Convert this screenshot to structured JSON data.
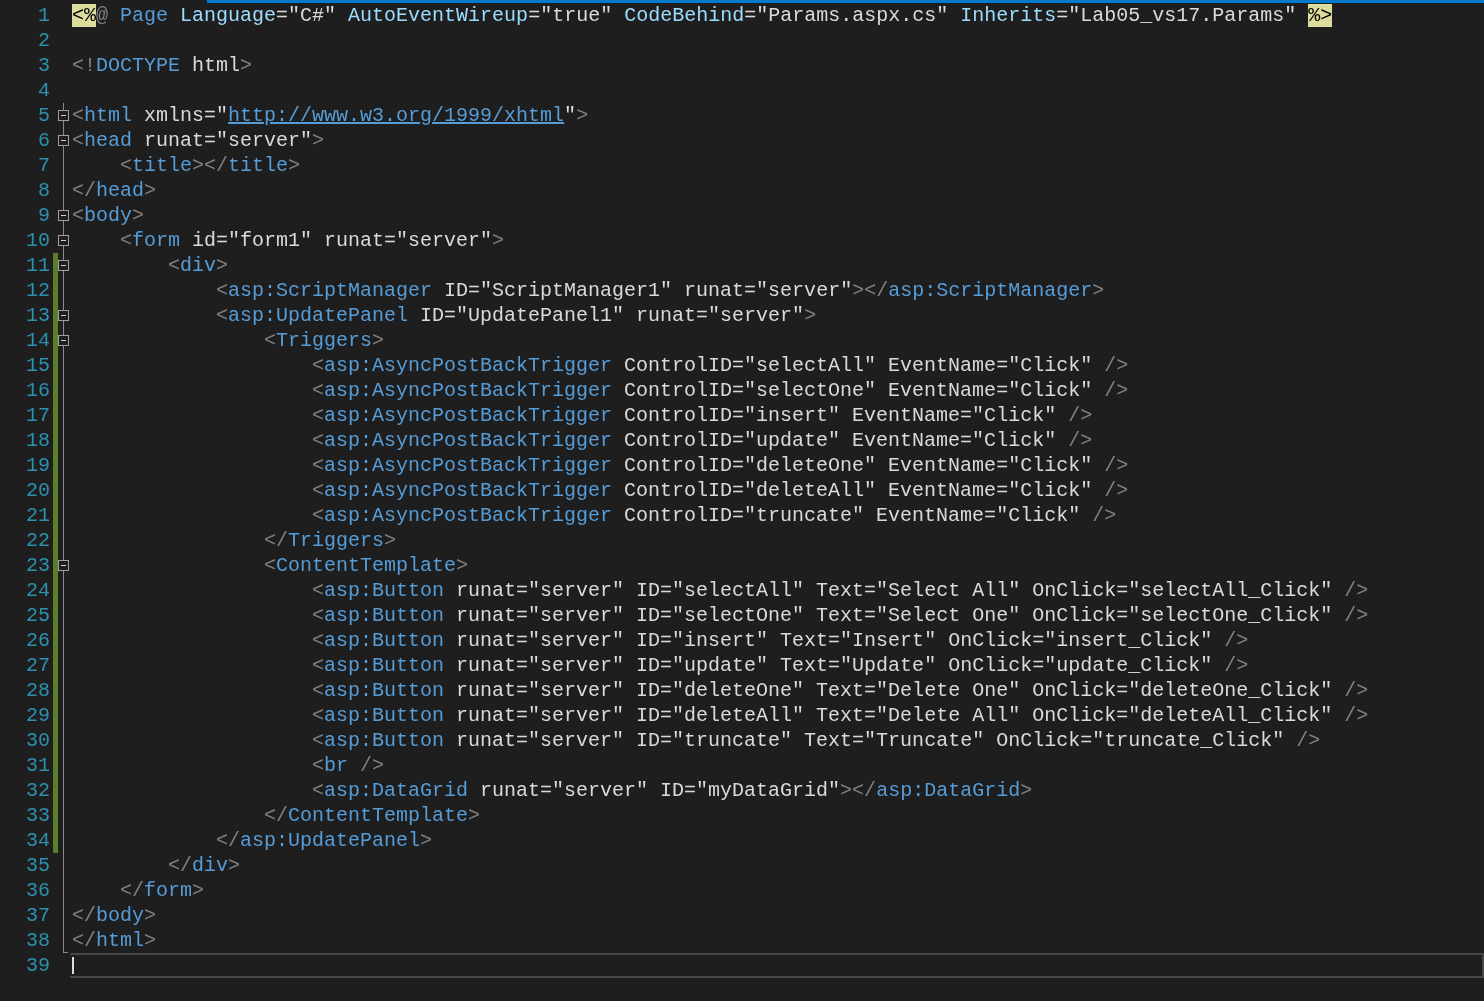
{
  "editor": {
    "lines": [
      {
        "number": "1",
        "changed": false,
        "fold_toggle": false,
        "current": false,
        "tokens": [
          {
            "kind": "directive",
            "text": "<%"
          },
          {
            "kind": "punct",
            "text": "@"
          },
          {
            "kind": "tag",
            "text": " Page"
          },
          {
            "kind": "attr",
            "text": " Language"
          },
          {
            "kind": "text",
            "text": "=\"C#\""
          },
          {
            "kind": "attr",
            "text": " AutoEventWireup"
          },
          {
            "kind": "text",
            "text": "=\"true\""
          },
          {
            "kind": "attr",
            "text": " CodeBehind"
          },
          {
            "kind": "text",
            "text": "=\"Params.aspx.cs\""
          },
          {
            "kind": "attr",
            "text": " Inherits"
          },
          {
            "kind": "text",
            "text": "=\"Lab05_vs17.Params\" "
          },
          {
            "kind": "directive",
            "text": "%>"
          }
        ]
      },
      {
        "number": "2",
        "changed": false,
        "fold_toggle": false,
        "current": false
      },
      {
        "number": "3",
        "changed": false,
        "fold_toggle": false,
        "current": false,
        "tokens": [
          {
            "kind": "punct",
            "text": "<!"
          },
          {
            "kind": "tag",
            "text": "DOCTYPE"
          },
          {
            "kind": "text",
            "text": " html"
          },
          {
            "kind": "punct",
            "text": ">"
          }
        ]
      },
      {
        "number": "4",
        "changed": false,
        "fold_toggle": false,
        "current": false
      },
      {
        "number": "5",
        "changed": false,
        "fold_toggle": true,
        "current": false,
        "tokens": [
          {
            "kind": "punct",
            "text": "<"
          },
          {
            "kind": "tag",
            "text": "html"
          },
          {
            "kind": "text",
            "text": " xmlns=\""
          },
          {
            "kind": "link",
            "text": "http://www.w3.org/1999/xhtml"
          },
          {
            "kind": "text",
            "text": "\""
          },
          {
            "kind": "punct",
            "text": ">"
          }
        ]
      },
      {
        "number": "6",
        "changed": false,
        "fold_toggle": true,
        "current": false,
        "tokens": [
          {
            "kind": "punct",
            "text": "<"
          },
          {
            "kind": "tag",
            "text": "head"
          },
          {
            "kind": "text",
            "text": " runat=\"server\""
          },
          {
            "kind": "punct",
            "text": ">"
          }
        ]
      },
      {
        "number": "7",
        "changed": false,
        "fold_toggle": false,
        "current": false,
        "tokens": [
          {
            "kind": "indent"
          },
          {
            "kind": "punct",
            "text": "<"
          },
          {
            "kind": "tag",
            "text": "title"
          },
          {
            "kind": "punct",
            "text": "></"
          },
          {
            "kind": "tag",
            "text": "title"
          },
          {
            "kind": "punct",
            "text": ">"
          }
        ]
      },
      {
        "number": "8",
        "changed": false,
        "fold_toggle": false,
        "current": false,
        "tokens": [
          {
            "kind": "punct",
            "text": "</"
          },
          {
            "kind": "tag",
            "text": "head"
          },
          {
            "kind": "punct",
            "text": ">"
          }
        ]
      },
      {
        "number": "9",
        "changed": false,
        "fold_toggle": true,
        "current": false,
        "tokens": [
          {
            "kind": "punct",
            "text": "<"
          },
          {
            "kind": "tag",
            "text": "body"
          },
          {
            "kind": "punct",
            "text": ">"
          }
        ]
      },
      {
        "number": "10",
        "changed": false,
        "fold_toggle": true,
        "current": false,
        "tokens": [
          {
            "kind": "indent"
          },
          {
            "kind": "punct",
            "text": "<"
          },
          {
            "kind": "tag",
            "text": "form"
          },
          {
            "kind": "text",
            "text": " id=\"form1\" runat=\"server\""
          },
          {
            "kind": "punct",
            "text": ">"
          }
        ]
      },
      {
        "number": "11",
        "changed": true,
        "fold_toggle": true,
        "current": false,
        "tokens": [
          {
            "kind": "indent"
          },
          {
            "kind": "indent"
          },
          {
            "kind": "punct",
            "text": "<"
          },
          {
            "kind": "tag",
            "text": "div"
          },
          {
            "kind": "punct",
            "text": ">"
          }
        ]
      },
      {
        "number": "12",
        "changed": true,
        "fold_toggle": false,
        "current": false,
        "tokens": [
          {
            "kind": "indent"
          },
          {
            "kind": "indent"
          },
          {
            "kind": "indent"
          },
          {
            "kind": "punct",
            "text": "<"
          },
          {
            "kind": "tag",
            "text": "asp:ScriptManager"
          },
          {
            "kind": "text",
            "text": " ID=\"ScriptManager1\" runat=\"server\""
          },
          {
            "kind": "punct",
            "text": "></"
          },
          {
            "kind": "tag",
            "text": "asp:ScriptManager"
          },
          {
            "kind": "punct",
            "text": ">"
          }
        ]
      },
      {
        "number": "13",
        "changed": true,
        "fold_toggle": true,
        "current": false,
        "tokens": [
          {
            "kind": "indent"
          },
          {
            "kind": "indent"
          },
          {
            "kind": "indent"
          },
          {
            "kind": "punct",
            "text": "<"
          },
          {
            "kind": "tag",
            "text": "asp:UpdatePanel"
          },
          {
            "kind": "text",
            "text": " ID=\"UpdatePanel1\" runat=\"server\""
          },
          {
            "kind": "punct",
            "text": ">"
          }
        ]
      },
      {
        "number": "14",
        "changed": true,
        "fold_toggle": true,
        "current": false,
        "tokens": [
          {
            "kind": "indent"
          },
          {
            "kind": "indent"
          },
          {
            "kind": "indent"
          },
          {
            "kind": "indent"
          },
          {
            "kind": "punct",
            "text": "<"
          },
          {
            "kind": "tag",
            "text": "Triggers"
          },
          {
            "kind": "punct",
            "text": ">"
          }
        ]
      },
      {
        "number": "15",
        "changed": true,
        "fold_toggle": false,
        "current": false,
        "tokens": [
          {
            "kind": "indent"
          },
          {
            "kind": "indent"
          },
          {
            "kind": "indent"
          },
          {
            "kind": "indent"
          },
          {
            "kind": "indent"
          },
          {
            "kind": "punct",
            "text": "<"
          },
          {
            "kind": "tag",
            "text": "asp:AsyncPostBackTrigger"
          },
          {
            "kind": "text",
            "text": " ControlID=\"selectAll\" EventName=\"Click\" "
          },
          {
            "kind": "punct",
            "text": "/>"
          }
        ]
      },
      {
        "number": "16",
        "changed": true,
        "fold_toggle": false,
        "current": false,
        "tokens": [
          {
            "kind": "indent"
          },
          {
            "kind": "indent"
          },
          {
            "kind": "indent"
          },
          {
            "kind": "indent"
          },
          {
            "kind": "indent"
          },
          {
            "kind": "punct",
            "text": "<"
          },
          {
            "kind": "tag",
            "text": "asp:AsyncPostBackTrigger"
          },
          {
            "kind": "text",
            "text": " ControlID=\"selectOne\" EventName=\"Click\" "
          },
          {
            "kind": "punct",
            "text": "/>"
          }
        ]
      },
      {
        "number": "17",
        "changed": true,
        "fold_toggle": false,
        "current": false,
        "tokens": [
          {
            "kind": "indent"
          },
          {
            "kind": "indent"
          },
          {
            "kind": "indent"
          },
          {
            "kind": "indent"
          },
          {
            "kind": "indent"
          },
          {
            "kind": "punct",
            "text": "<"
          },
          {
            "kind": "tag",
            "text": "asp:AsyncPostBackTrigger"
          },
          {
            "kind": "text",
            "text": " ControlID=\"insert\" EventName=\"Click\" "
          },
          {
            "kind": "punct",
            "text": "/>"
          }
        ]
      },
      {
        "number": "18",
        "changed": true,
        "fold_toggle": false,
        "current": false,
        "tokens": [
          {
            "kind": "indent"
          },
          {
            "kind": "indent"
          },
          {
            "kind": "indent"
          },
          {
            "kind": "indent"
          },
          {
            "kind": "indent"
          },
          {
            "kind": "punct",
            "text": "<"
          },
          {
            "kind": "tag",
            "text": "asp:AsyncPostBackTrigger"
          },
          {
            "kind": "text",
            "text": " ControlID=\"update\" EventName=\"Click\" "
          },
          {
            "kind": "punct",
            "text": "/>"
          }
        ]
      },
      {
        "number": "19",
        "changed": true,
        "fold_toggle": false,
        "current": false,
        "tokens": [
          {
            "kind": "indent"
          },
          {
            "kind": "indent"
          },
          {
            "kind": "indent"
          },
          {
            "kind": "indent"
          },
          {
            "kind": "indent"
          },
          {
            "kind": "punct",
            "text": "<"
          },
          {
            "kind": "tag",
            "text": "asp:AsyncPostBackTrigger"
          },
          {
            "kind": "text",
            "text": " ControlID=\"deleteOne\" EventName=\"Click\" "
          },
          {
            "kind": "punct",
            "text": "/>"
          }
        ]
      },
      {
        "number": "20",
        "changed": true,
        "fold_toggle": false,
        "current": false,
        "tokens": [
          {
            "kind": "indent"
          },
          {
            "kind": "indent"
          },
          {
            "kind": "indent"
          },
          {
            "kind": "indent"
          },
          {
            "kind": "indent"
          },
          {
            "kind": "punct",
            "text": "<"
          },
          {
            "kind": "tag",
            "text": "asp:AsyncPostBackTrigger"
          },
          {
            "kind": "text",
            "text": " ControlID=\"deleteAll\" EventName=\"Click\" "
          },
          {
            "kind": "punct",
            "text": "/>"
          }
        ]
      },
      {
        "number": "21",
        "changed": true,
        "fold_toggle": false,
        "current": false,
        "tokens": [
          {
            "kind": "indent"
          },
          {
            "kind": "indent"
          },
          {
            "kind": "indent"
          },
          {
            "kind": "indent"
          },
          {
            "kind": "indent"
          },
          {
            "kind": "punct",
            "text": "<"
          },
          {
            "kind": "tag",
            "text": "asp:AsyncPostBackTrigger"
          },
          {
            "kind": "text",
            "text": " ControlID=\"truncate\" EventName=\"Click\" "
          },
          {
            "kind": "punct",
            "text": "/>"
          }
        ]
      },
      {
        "number": "22",
        "changed": true,
        "fold_toggle": false,
        "current": false,
        "tokens": [
          {
            "kind": "indent"
          },
          {
            "kind": "indent"
          },
          {
            "kind": "indent"
          },
          {
            "kind": "indent"
          },
          {
            "kind": "punct",
            "text": "</"
          },
          {
            "kind": "tag",
            "text": "Triggers"
          },
          {
            "kind": "punct",
            "text": ">"
          }
        ]
      },
      {
        "number": "23",
        "changed": true,
        "fold_toggle": true,
        "current": false,
        "tokens": [
          {
            "kind": "indent"
          },
          {
            "kind": "indent"
          },
          {
            "kind": "indent"
          },
          {
            "kind": "indent"
          },
          {
            "kind": "punct",
            "text": "<"
          },
          {
            "kind": "tag",
            "text": "ContentTemplate"
          },
          {
            "kind": "punct",
            "text": ">"
          }
        ]
      },
      {
        "number": "24",
        "changed": true,
        "fold_toggle": false,
        "current": false,
        "tokens": [
          {
            "kind": "indent"
          },
          {
            "kind": "indent"
          },
          {
            "kind": "indent"
          },
          {
            "kind": "indent"
          },
          {
            "kind": "indent"
          },
          {
            "kind": "punct",
            "text": "<"
          },
          {
            "kind": "tag",
            "text": "asp:Button"
          },
          {
            "kind": "text",
            "text": " runat=\"server\" ID=\"selectAll\" Text=\"Select All\" OnClick=\"selectAll_Click\" "
          },
          {
            "kind": "punct",
            "text": "/>"
          }
        ]
      },
      {
        "number": "25",
        "changed": true,
        "fold_toggle": false,
        "current": false,
        "tokens": [
          {
            "kind": "indent"
          },
          {
            "kind": "indent"
          },
          {
            "kind": "indent"
          },
          {
            "kind": "indent"
          },
          {
            "kind": "indent"
          },
          {
            "kind": "punct",
            "text": "<"
          },
          {
            "kind": "tag",
            "text": "asp:Button"
          },
          {
            "kind": "text",
            "text": " runat=\"server\" ID=\"selectOne\" Text=\"Select One\" OnClick=\"selectOne_Click\" "
          },
          {
            "kind": "punct",
            "text": "/>"
          }
        ]
      },
      {
        "number": "26",
        "changed": true,
        "fold_toggle": false,
        "current": false,
        "tokens": [
          {
            "kind": "indent"
          },
          {
            "kind": "indent"
          },
          {
            "kind": "indent"
          },
          {
            "kind": "indent"
          },
          {
            "kind": "indent"
          },
          {
            "kind": "punct",
            "text": "<"
          },
          {
            "kind": "tag",
            "text": "asp:Button"
          },
          {
            "kind": "text",
            "text": " runat=\"server\" ID=\"insert\" Text=\"Insert\" OnClick=\"insert_Click\" "
          },
          {
            "kind": "punct",
            "text": "/>"
          }
        ]
      },
      {
        "number": "27",
        "changed": true,
        "fold_toggle": false,
        "current": false,
        "tokens": [
          {
            "kind": "indent"
          },
          {
            "kind": "indent"
          },
          {
            "kind": "indent"
          },
          {
            "kind": "indent"
          },
          {
            "kind": "indent"
          },
          {
            "kind": "punct",
            "text": "<"
          },
          {
            "kind": "tag",
            "text": "asp:Button"
          },
          {
            "kind": "text",
            "text": " runat=\"server\" ID=\"update\" Text=\"Update\" OnClick=\"update_Click\" "
          },
          {
            "kind": "punct",
            "text": "/>"
          }
        ]
      },
      {
        "number": "28",
        "changed": true,
        "fold_toggle": false,
        "current": false,
        "tokens": [
          {
            "kind": "indent"
          },
          {
            "kind": "indent"
          },
          {
            "kind": "indent"
          },
          {
            "kind": "indent"
          },
          {
            "kind": "indent"
          },
          {
            "kind": "punct",
            "text": "<"
          },
          {
            "kind": "tag",
            "text": "asp:Button"
          },
          {
            "kind": "text",
            "text": " runat=\"server\" ID=\"deleteOne\" Text=\"Delete One\" OnClick=\"deleteOne_Click\" "
          },
          {
            "kind": "punct",
            "text": "/>"
          }
        ]
      },
      {
        "number": "29",
        "changed": true,
        "fold_toggle": false,
        "current": false,
        "tokens": [
          {
            "kind": "indent"
          },
          {
            "kind": "indent"
          },
          {
            "kind": "indent"
          },
          {
            "kind": "indent"
          },
          {
            "kind": "indent"
          },
          {
            "kind": "punct",
            "text": "<"
          },
          {
            "kind": "tag",
            "text": "asp:Button"
          },
          {
            "kind": "text",
            "text": " runat=\"server\" ID=\"deleteAll\" Text=\"Delete All\" OnClick=\"deleteAll_Click\" "
          },
          {
            "kind": "punct",
            "text": "/>"
          }
        ]
      },
      {
        "number": "30",
        "changed": true,
        "fold_toggle": false,
        "current": false,
        "tokens": [
          {
            "kind": "indent"
          },
          {
            "kind": "indent"
          },
          {
            "kind": "indent"
          },
          {
            "kind": "indent"
          },
          {
            "kind": "indent"
          },
          {
            "kind": "punct",
            "text": "<"
          },
          {
            "kind": "tag",
            "text": "asp:Button"
          },
          {
            "kind": "text",
            "text": " runat=\"server\" ID=\"truncate\" Text=\"Truncate\" OnClick=\"truncate_Click\" "
          },
          {
            "kind": "punct",
            "text": "/>"
          }
        ]
      },
      {
        "number": "31",
        "changed": true,
        "fold_toggle": false,
        "current": false,
        "tokens": [
          {
            "kind": "indent"
          },
          {
            "kind": "indent"
          },
          {
            "kind": "indent"
          },
          {
            "kind": "indent"
          },
          {
            "kind": "indent"
          },
          {
            "kind": "punct",
            "text": "<"
          },
          {
            "kind": "tag",
            "text": "br"
          },
          {
            "kind": "punct",
            "text": " />"
          }
        ]
      },
      {
        "number": "32",
        "changed": true,
        "fold_toggle": false,
        "current": false,
        "tokens": [
          {
            "kind": "indent"
          },
          {
            "kind": "indent"
          },
          {
            "kind": "indent"
          },
          {
            "kind": "indent"
          },
          {
            "kind": "indent"
          },
          {
            "kind": "punct",
            "text": "<"
          },
          {
            "kind": "tag",
            "text": "asp:DataGrid"
          },
          {
            "kind": "text",
            "text": " runat=\"server\" ID=\"myDataGrid\""
          },
          {
            "kind": "punct",
            "text": "></"
          },
          {
            "kind": "tag",
            "text": "asp:DataGrid"
          },
          {
            "kind": "punct",
            "text": ">"
          }
        ]
      },
      {
        "number": "33",
        "changed": true,
        "fold_toggle": false,
        "current": false,
        "tokens": [
          {
            "kind": "indent"
          },
          {
            "kind": "indent"
          },
          {
            "kind": "indent"
          },
          {
            "kind": "indent"
          },
          {
            "kind": "punct",
            "text": "</"
          },
          {
            "kind": "tag",
            "text": "ContentTemplate"
          },
          {
            "kind": "punct",
            "text": ">"
          }
        ]
      },
      {
        "number": "34",
        "changed": true,
        "fold_toggle": false,
        "current": false,
        "tokens": [
          {
            "kind": "indent"
          },
          {
            "kind": "indent"
          },
          {
            "kind": "indent"
          },
          {
            "kind": "punct",
            "text": "</"
          },
          {
            "kind": "tag",
            "text": "asp:UpdatePanel"
          },
          {
            "kind": "punct",
            "text": ">"
          }
        ]
      },
      {
        "number": "35",
        "changed": false,
        "fold_toggle": false,
        "current": false,
        "tokens": [
          {
            "kind": "indent"
          },
          {
            "kind": "indent"
          },
          {
            "kind": "punct",
            "text": "</"
          },
          {
            "kind": "tag",
            "text": "div"
          },
          {
            "kind": "punct",
            "text": ">"
          }
        ]
      },
      {
        "number": "36",
        "changed": false,
        "fold_toggle": false,
        "current": false,
        "tokens": [
          {
            "kind": "indent"
          },
          {
            "kind": "punct",
            "text": "</"
          },
          {
            "kind": "tag",
            "text": "form"
          },
          {
            "kind": "punct",
            "text": ">"
          }
        ]
      },
      {
        "number": "37",
        "changed": false,
        "fold_toggle": false,
        "current": false,
        "tokens": [
          {
            "kind": "punct",
            "text": "</"
          },
          {
            "kind": "tag",
            "text": "body"
          },
          {
            "kind": "punct",
            "text": ">"
          }
        ]
      },
      {
        "number": "38",
        "changed": false,
        "fold_toggle": false,
        "current": false,
        "tokens": [
          {
            "kind": "punct",
            "text": "</"
          },
          {
            "kind": "tag",
            "text": "html"
          },
          {
            "kind": "punct",
            "text": ">"
          }
        ]
      },
      {
        "number": "39",
        "changed": false,
        "fold_toggle": false,
        "current": true
      }
    ]
  }
}
